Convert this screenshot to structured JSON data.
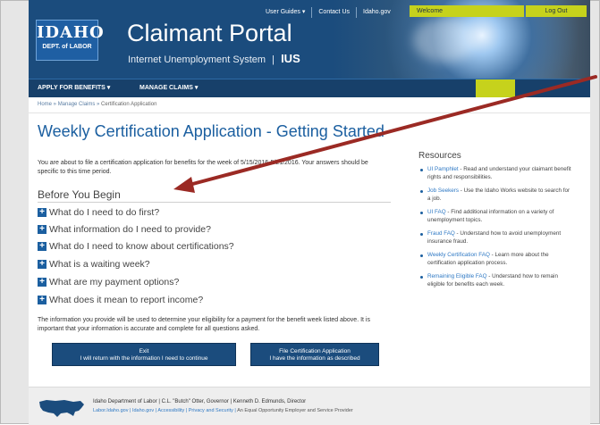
{
  "header": {
    "logo_main": "IDAHO",
    "logo_sub": "DEPT. of LABOR",
    "title": "Claimant Portal",
    "subtitle": "Internet Unemployment System",
    "subtitle_sep": "|",
    "subtitle_mark": "IUS",
    "top_links": [
      "User Guides ▾",
      "Contact Us",
      "Idaho.gov"
    ],
    "welcome": "Welcome",
    "logout": "Log Out"
  },
  "nav": {
    "items": [
      "APPLY FOR BENEFITS ▾",
      "MANAGE CLAIMS ▾"
    ]
  },
  "breadcrumb": {
    "home": "Home",
    "manage": "Manage Claims",
    "current": "Certification Application"
  },
  "main": {
    "title": "Weekly Certification Application - Getting Started",
    "intro": "You are about to file a certification application for benefits for the week of 5/15/2016-5/21/2016. Your answers should be specific to this time period.",
    "section_title": "Before You Begin",
    "faq": [
      "What do I need to do first?",
      "What information do I need to provide?",
      "What do I need to know about certifications?",
      "What is a waiting week?",
      "What are my payment options?",
      "What does it mean to report income?"
    ],
    "note": "The information you provide will be used to determine your eligibility for a payment for the benefit week listed above. It is important that your information is accurate and complete for all questions asked.",
    "exit_button": {
      "line1": "Exit",
      "line2": "I will return with the information I need to continue"
    },
    "file_button": {
      "line1": "File Certification Application",
      "line2": "I have the information as described"
    }
  },
  "resources": {
    "title": "Resources",
    "items": [
      {
        "link": "UI Pamphlet",
        "text": " - Read and understand your claimant benefit rights and responsibilities."
      },
      {
        "link": "Job Seekers",
        "text": " - Use the Idaho Works website to search for a job."
      },
      {
        "link": "UI FAQ",
        "text": " - Find additional information on a variety of unemployment topics."
      },
      {
        "link": "Fraud FAQ",
        "text": " - Understand how to avoid unemployment insurance fraud."
      },
      {
        "link": "Weekly Certification FAQ",
        "text": " - Learn more about the certification application process."
      },
      {
        "link": "Remaining Eligible FAQ",
        "text": " - Understand how to remain eligible for benefits each week."
      }
    ]
  },
  "footer": {
    "line1": "Idaho Department of Labor | C.L. \"Butch\" Otter, Governor | Kenneth D. Edmunds, Director",
    "links": [
      "Labor.Idaho.gov",
      "Idaho.gov",
      "Accessibility",
      "Privacy and Security"
    ],
    "tagline": "An Equal Opportunity Employer and Service Provider"
  },
  "colors": {
    "header_blue": "#1b4c7d",
    "accent_lime": "#c6d21c",
    "title_blue": "#1b5fa0",
    "arrow_red": "#9b2a24"
  }
}
